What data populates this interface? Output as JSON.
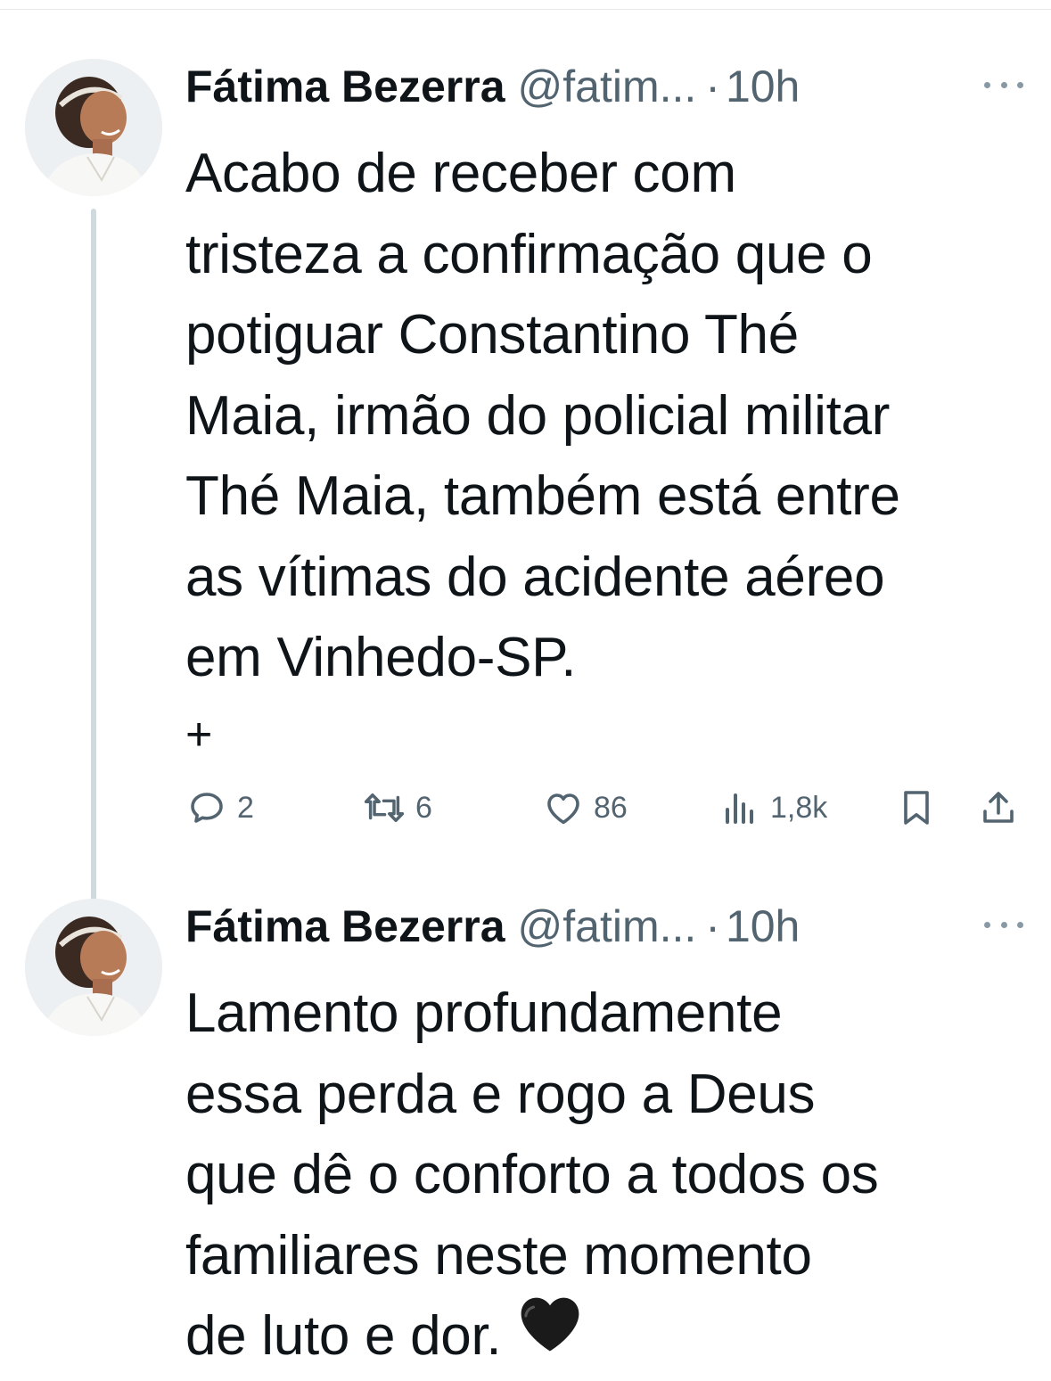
{
  "tweets": [
    {
      "author_name": "Fátima Bezerra",
      "handle": "@fatim...",
      "separator": "·",
      "time": "10h",
      "text": "Acabo de receber com\ntristeza a confirmação que o\npotiguar Constantino Thé\nMaia, irmão do policial militar\nThé Maia, também está entre\nas vítimas do acidente aéreo\nem Vinhedo-SP.",
      "continuation": "+",
      "stats": {
        "replies": "2",
        "retweets": "6",
        "likes": "86",
        "views": "1,8k"
      }
    },
    {
      "author_name": "Fátima Bezerra",
      "handle": "@fatim...",
      "separator": "·",
      "time": "10h",
      "text": "Lamento profundamente\nessa perda e rogo a Deus\nque dê o conforto a todos os\nfamiliares neste momento\nde luto e dor.",
      "emoji": "black-heart"
    }
  ],
  "icons": {
    "reply": "reply-icon",
    "retweet": "retweet-icon",
    "like": "like-icon",
    "views": "views-icon",
    "bookmark": "bookmark-icon",
    "share": "share-icon",
    "more": "more-icon"
  },
  "colors": {
    "text": "#0f1419",
    "secondary": "#536471",
    "thread_line": "#cfd9de",
    "divider": "#e6e9ec"
  }
}
